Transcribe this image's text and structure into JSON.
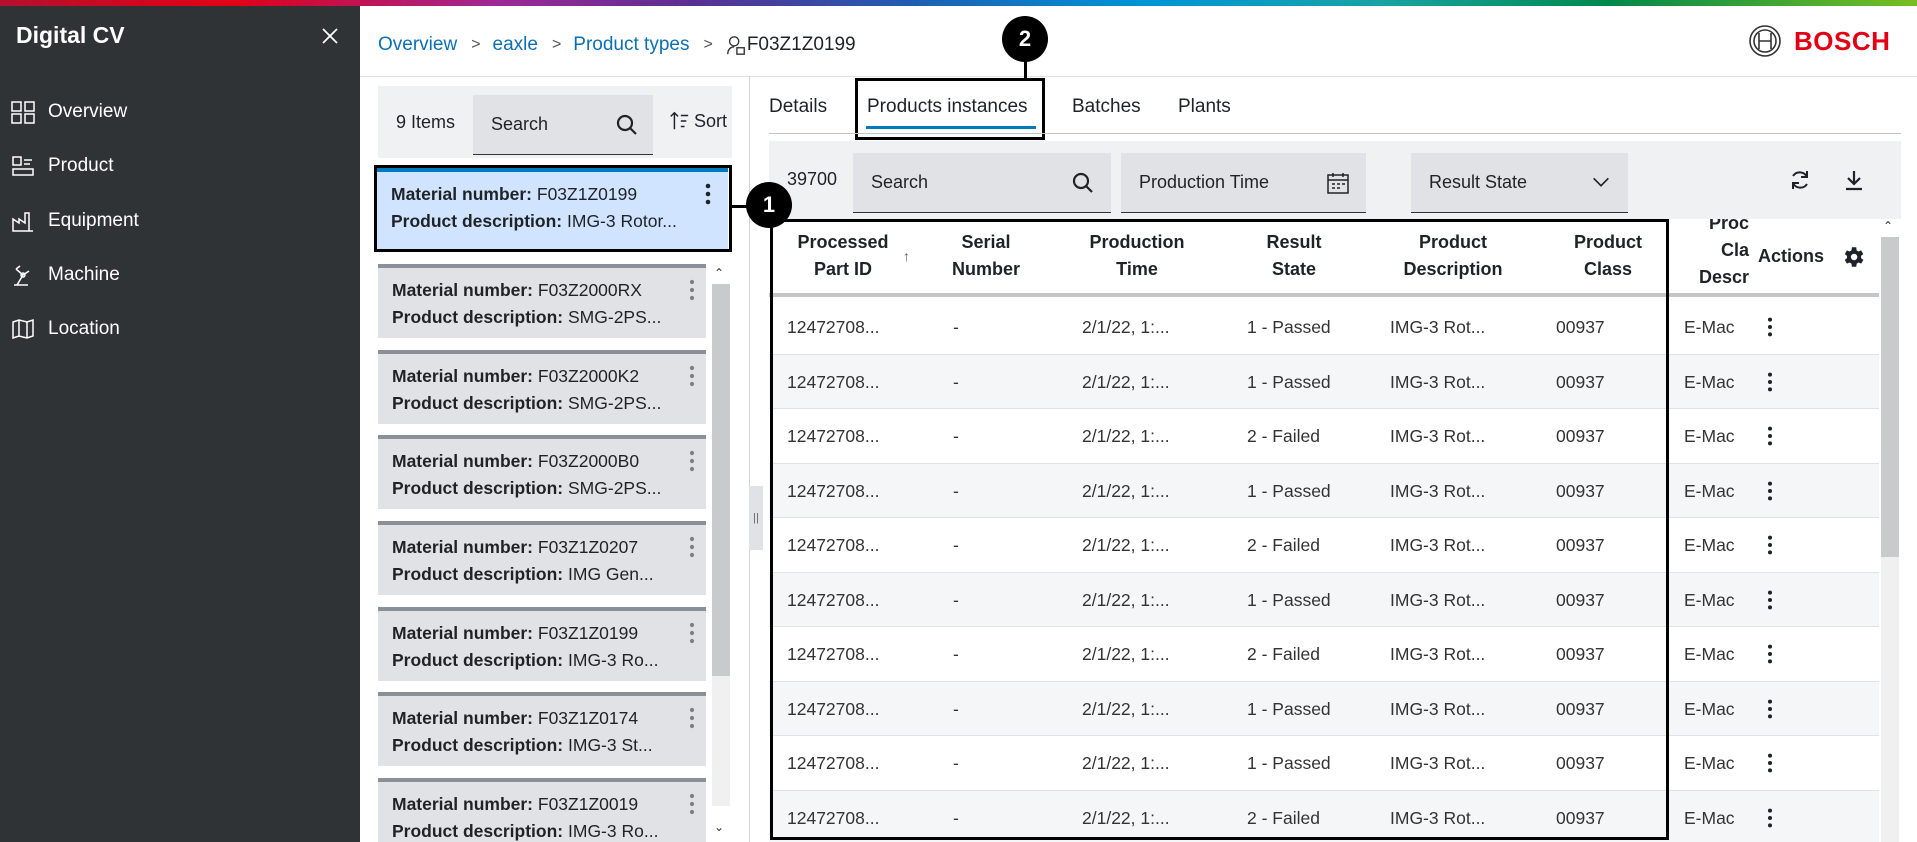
{
  "app": {
    "title": "Digital CV"
  },
  "sidebar": {
    "items": [
      {
        "label": "Overview",
        "icon": "grid-icon"
      },
      {
        "label": "Product",
        "icon": "product-icon"
      },
      {
        "label": "Equipment",
        "icon": "factory-icon"
      },
      {
        "label": "Machine",
        "icon": "machine-icon"
      },
      {
        "label": "Location",
        "icon": "map-icon"
      }
    ]
  },
  "breadcrumb": {
    "items": [
      "Overview",
      "eaxle",
      "Product types"
    ],
    "current": "F03Z1Z0199"
  },
  "brand": {
    "name": "BOSCH",
    "color": "#e20015"
  },
  "list": {
    "count": "9 Items",
    "search_placeholder": "Search",
    "sort_label": "Sort",
    "material_label": "Material number:",
    "description_label": "Product description:",
    "cards": [
      {
        "material": "F03Z1Z0199",
        "description": "IMG-3 Rotor...",
        "selected": true
      },
      {
        "material": "F03Z2000RX",
        "description": "SMG-2PS..."
      },
      {
        "material": "F03Z2000K2",
        "description": "SMG-2PS..."
      },
      {
        "material": "F03Z2000B0",
        "description": "SMG-2PS..."
      },
      {
        "material": "F03Z1Z0207",
        "description": "IMG Gen..."
      },
      {
        "material": "F03Z1Z0199",
        "description": "IMG-3 Ro..."
      },
      {
        "material": "F03Z1Z0174",
        "description": "IMG-3 St..."
      },
      {
        "material": "F03Z1Z0019",
        "description": "IMG-3 Ro..."
      }
    ]
  },
  "tabs": [
    {
      "label": "Details"
    },
    {
      "label": "Products instances",
      "active": true
    },
    {
      "label": "Batches"
    },
    {
      "label": "Plants"
    }
  ],
  "table_toolbar": {
    "count": "39700",
    "search_placeholder": "Search",
    "production_time_placeholder": "Production Time",
    "result_state_placeholder": "Result State"
  },
  "table": {
    "headers": {
      "processed_part_id": [
        "Processed",
        "Part ID"
      ],
      "serial_number": [
        "Serial",
        "Number"
      ],
      "production_time": [
        "Production",
        "Time"
      ],
      "result_state": [
        "Result",
        "State"
      ],
      "product_description": [
        "Product",
        "Description"
      ],
      "product_class": [
        "Product",
        "Class"
      ],
      "product_class_description": [
        "Proc",
        "Cla",
        "Descr"
      ],
      "actions": "Actions"
    },
    "rows": [
      {
        "id": "12472708...",
        "serial": "-",
        "time": "2/1/22, 1:...",
        "state": "1 - Passed",
        "desc": "IMG-3 Rot...",
        "cls": "00937",
        "cls_desc": "E-Mac"
      },
      {
        "id": "12472708...",
        "serial": "-",
        "time": "2/1/22, 1:...",
        "state": "1 - Passed",
        "desc": "IMG-3 Rot...",
        "cls": "00937",
        "cls_desc": "E-Mac"
      },
      {
        "id": "12472708...",
        "serial": "-",
        "time": "2/1/22, 1:...",
        "state": "2 - Failed",
        "desc": "IMG-3 Rot...",
        "cls": "00937",
        "cls_desc": "E-Mac"
      },
      {
        "id": "12472708...",
        "serial": "-",
        "time": "2/1/22, 1:...",
        "state": "1 - Passed",
        "desc": "IMG-3 Rot...",
        "cls": "00937",
        "cls_desc": "E-Mac"
      },
      {
        "id": "12472708...",
        "serial": "-",
        "time": "2/1/22, 1:...",
        "state": "2 - Failed",
        "desc": "IMG-3 Rot...",
        "cls": "00937",
        "cls_desc": "E-Mac"
      },
      {
        "id": "12472708...",
        "serial": "-",
        "time": "2/1/22, 1:...",
        "state": "1 - Passed",
        "desc": "IMG-3 Rot...",
        "cls": "00937",
        "cls_desc": "E-Mac"
      },
      {
        "id": "12472708...",
        "serial": "-",
        "time": "2/1/22, 1:...",
        "state": "2 - Failed",
        "desc": "IMG-3 Rot...",
        "cls": "00937",
        "cls_desc": "E-Mac"
      },
      {
        "id": "12472708...",
        "serial": "-",
        "time": "2/1/22, 1:...",
        "state": "1 - Passed",
        "desc": "IMG-3 Rot...",
        "cls": "00937",
        "cls_desc": "E-Mac"
      },
      {
        "id": "12472708...",
        "serial": "-",
        "time": "2/1/22, 1:...",
        "state": "1 - Passed",
        "desc": "IMG-3 Rot...",
        "cls": "00937",
        "cls_desc": "E-Mac"
      },
      {
        "id": "12472708...",
        "serial": "-",
        "time": "2/1/22, 1:...",
        "state": "2 - Failed",
        "desc": "IMG-3 Rot...",
        "cls": "00937",
        "cls_desc": "E-Mac"
      }
    ]
  },
  "callouts": [
    "1",
    "2"
  ]
}
